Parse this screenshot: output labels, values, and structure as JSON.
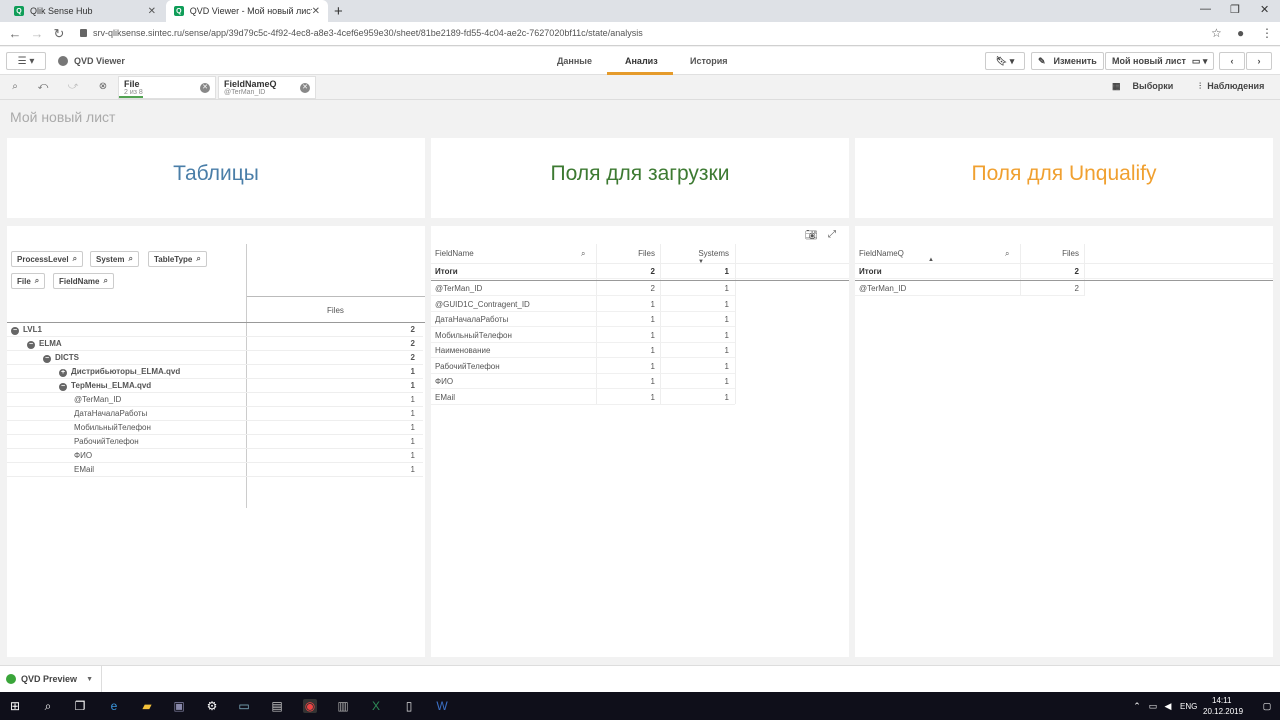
{
  "browser": {
    "tabs": [
      {
        "label": "Qlik Sense Hub",
        "active": false
      },
      {
        "label": "QVD Viewer - Мой новый лист",
        "active": true
      }
    ],
    "url": "srv-qliksense.sintec.ru/sense/app/39d79c5c-4f92-4ec8-a8e3-4cef6e959e30/sheet/81be2189-fd55-4c04-ae2c-7627020bf11c/state/analysis"
  },
  "header": {
    "app_name": "QVD Viewer",
    "nav": [
      "Данные",
      "Анализ",
      "История"
    ],
    "edit_label": "Изменить",
    "sheet_label": "Мой новый лист"
  },
  "selections": {
    "chips": [
      {
        "field": "File",
        "value": "2 из 8"
      },
      {
        "field": "FieldNameQ",
        "value": "@TerMan_ID"
      }
    ],
    "right_buttons": [
      "Выборки",
      "Наблюдения"
    ]
  },
  "sheet_title": "Мой новый лист",
  "panels": {
    "tables_title": "Таблицы",
    "fields_title": "Поля для загрузки",
    "unqualify_title": "Поля для Unqualify"
  },
  "colors": {
    "tables": "#4a7ea8",
    "fields": "#3d7a32",
    "unqualify": "#f0a030",
    "accent": "#e59b2b"
  },
  "pivot": {
    "dimensions": [
      "ProcessLevel",
      "System",
      "TableType",
      "File",
      "FieldName"
    ],
    "measure": "Files",
    "rows": [
      {
        "label": "LVL1",
        "value": "2",
        "level": 0,
        "bold": true,
        "icon": "minus"
      },
      {
        "label": "ELMA",
        "value": "2",
        "level": 1,
        "bold": true,
        "icon": "minus"
      },
      {
        "label": "DICTS",
        "value": "2",
        "level": 2,
        "bold": true,
        "icon": "minus"
      },
      {
        "label": "Дистрибьюторы_ELMA.qvd",
        "value": "1",
        "level": 3,
        "bold": true,
        "icon": "plus"
      },
      {
        "label": "ТерМены_ELMA.qvd",
        "value": "1",
        "level": 3,
        "bold": true,
        "icon": "minus"
      },
      {
        "label": "@TerMan_ID",
        "value": "1",
        "level": 4,
        "bold": false,
        "icon": ""
      },
      {
        "label": "ДатаНачалаРаботы",
        "value": "1",
        "level": 4,
        "bold": false,
        "icon": ""
      },
      {
        "label": "МобильныйТелефон",
        "value": "1",
        "level": 4,
        "bold": false,
        "icon": ""
      },
      {
        "label": "РабочийТелефон",
        "value": "1",
        "level": 4,
        "bold": false,
        "icon": ""
      },
      {
        "label": "ФИО",
        "value": "1",
        "level": 4,
        "bold": false,
        "icon": ""
      },
      {
        "label": "EMail",
        "value": "1",
        "level": 4,
        "bold": false,
        "icon": ""
      }
    ]
  },
  "fields_table": {
    "columns": [
      "FieldName",
      "Files",
      "Systems"
    ],
    "totals_label": "Итоги",
    "totals": [
      "2",
      "1"
    ],
    "rows": [
      [
        "@TerMan_ID",
        "2",
        "1"
      ],
      [
        "@GUID1C_Contragent_ID",
        "1",
        "1"
      ],
      [
        "ДатаНачалаРаботы",
        "1",
        "1"
      ],
      [
        "МобильныйТелефон",
        "1",
        "1"
      ],
      [
        "Наименование",
        "1",
        "1"
      ],
      [
        "РабочийТелефон",
        "1",
        "1"
      ],
      [
        "ФИО",
        "1",
        "1"
      ],
      [
        "EMail",
        "1",
        "1"
      ]
    ]
  },
  "unqualify_table": {
    "columns": [
      "FieldNameQ",
      "Files"
    ],
    "totals_label": "Итоги",
    "totals": [
      "2"
    ],
    "rows": [
      [
        "@TerMan_ID",
        "2"
      ]
    ]
  },
  "bottom": {
    "sheet_tab": "QVD Preview"
  },
  "taskbar": {
    "lang": "ENG",
    "time": "14:11",
    "date": "20.12.2019"
  }
}
